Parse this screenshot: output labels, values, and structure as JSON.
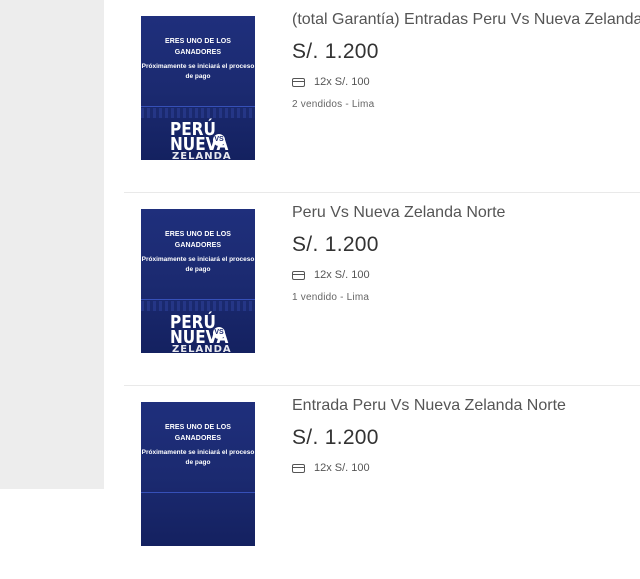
{
  "listings": [
    {
      "title": "(total Garantía) Entradas Peru Vs Nueva Zelanda",
      "price": "S/. 1.200",
      "installments": "12x S/. 100",
      "sold": "2 vendidos - Lima",
      "thumb": {
        "line1": "ERES UNO DE LOS GANADORES",
        "line2": "Próximamente se iniciará el proceso de pago",
        "peru": "PERÚ",
        "nueva": "NUEVA",
        "vs": "VS",
        "zelanda": "ZELANDA"
      }
    },
    {
      "title": "Peru Vs Nueva Zelanda Norte",
      "price": "S/. 1.200",
      "installments": "12x S/. 100",
      "sold": "1 vendido - Lima",
      "thumb": {
        "line1": "ERES UNO DE LOS GANADORES",
        "line2": "Próximamente se iniciará el proceso de pago",
        "peru": "PERÚ",
        "nueva": "NUEVA",
        "vs": "VS",
        "zelanda": "ZELANDA"
      }
    },
    {
      "title": "Entrada Peru Vs Nueva Zelanda Norte",
      "price": "S/. 1.200",
      "installments": "12x S/. 100",
      "sold": "",
      "thumb": {
        "line1": "ERES UNO DE LOS GANADORES",
        "line2": "Próximamente se iniciará el proceso de pago",
        "peru": "",
        "nueva": "",
        "vs": "",
        "zelanda": ""
      }
    }
  ],
  "icons": {
    "installments_icon": "credit-card-icon"
  }
}
